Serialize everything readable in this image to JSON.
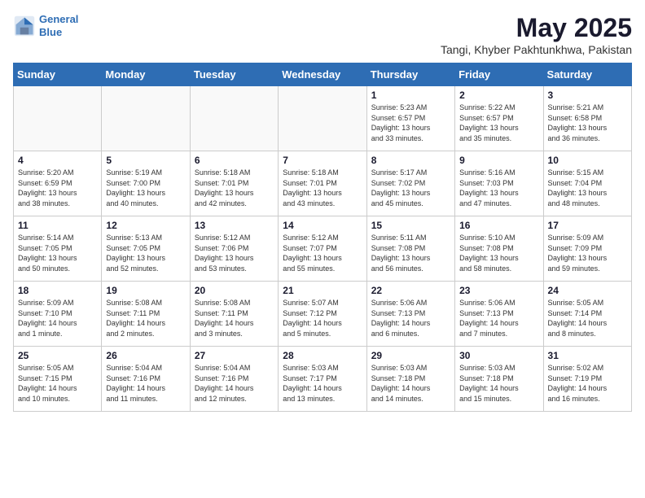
{
  "header": {
    "logo_line1": "General",
    "logo_line2": "Blue",
    "title": "May 2025",
    "subtitle": "Tangi, Khyber Pakhtunkhwa, Pakistan"
  },
  "weekdays": [
    "Sunday",
    "Monday",
    "Tuesday",
    "Wednesday",
    "Thursday",
    "Friday",
    "Saturday"
  ],
  "weeks": [
    [
      {
        "day": "",
        "info": ""
      },
      {
        "day": "",
        "info": ""
      },
      {
        "day": "",
        "info": ""
      },
      {
        "day": "",
        "info": ""
      },
      {
        "day": "1",
        "info": "Sunrise: 5:23 AM\nSunset: 6:57 PM\nDaylight: 13 hours\nand 33 minutes."
      },
      {
        "day": "2",
        "info": "Sunrise: 5:22 AM\nSunset: 6:57 PM\nDaylight: 13 hours\nand 35 minutes."
      },
      {
        "day": "3",
        "info": "Sunrise: 5:21 AM\nSunset: 6:58 PM\nDaylight: 13 hours\nand 36 minutes."
      }
    ],
    [
      {
        "day": "4",
        "info": "Sunrise: 5:20 AM\nSunset: 6:59 PM\nDaylight: 13 hours\nand 38 minutes."
      },
      {
        "day": "5",
        "info": "Sunrise: 5:19 AM\nSunset: 7:00 PM\nDaylight: 13 hours\nand 40 minutes."
      },
      {
        "day": "6",
        "info": "Sunrise: 5:18 AM\nSunset: 7:01 PM\nDaylight: 13 hours\nand 42 minutes."
      },
      {
        "day": "7",
        "info": "Sunrise: 5:18 AM\nSunset: 7:01 PM\nDaylight: 13 hours\nand 43 minutes."
      },
      {
        "day": "8",
        "info": "Sunrise: 5:17 AM\nSunset: 7:02 PM\nDaylight: 13 hours\nand 45 minutes."
      },
      {
        "day": "9",
        "info": "Sunrise: 5:16 AM\nSunset: 7:03 PM\nDaylight: 13 hours\nand 47 minutes."
      },
      {
        "day": "10",
        "info": "Sunrise: 5:15 AM\nSunset: 7:04 PM\nDaylight: 13 hours\nand 48 minutes."
      }
    ],
    [
      {
        "day": "11",
        "info": "Sunrise: 5:14 AM\nSunset: 7:05 PM\nDaylight: 13 hours\nand 50 minutes."
      },
      {
        "day": "12",
        "info": "Sunrise: 5:13 AM\nSunset: 7:05 PM\nDaylight: 13 hours\nand 52 minutes."
      },
      {
        "day": "13",
        "info": "Sunrise: 5:12 AM\nSunset: 7:06 PM\nDaylight: 13 hours\nand 53 minutes."
      },
      {
        "day": "14",
        "info": "Sunrise: 5:12 AM\nSunset: 7:07 PM\nDaylight: 13 hours\nand 55 minutes."
      },
      {
        "day": "15",
        "info": "Sunrise: 5:11 AM\nSunset: 7:08 PM\nDaylight: 13 hours\nand 56 minutes."
      },
      {
        "day": "16",
        "info": "Sunrise: 5:10 AM\nSunset: 7:08 PM\nDaylight: 13 hours\nand 58 minutes."
      },
      {
        "day": "17",
        "info": "Sunrise: 5:09 AM\nSunset: 7:09 PM\nDaylight: 13 hours\nand 59 minutes."
      }
    ],
    [
      {
        "day": "18",
        "info": "Sunrise: 5:09 AM\nSunset: 7:10 PM\nDaylight: 14 hours\nand 1 minute."
      },
      {
        "day": "19",
        "info": "Sunrise: 5:08 AM\nSunset: 7:11 PM\nDaylight: 14 hours\nand 2 minutes."
      },
      {
        "day": "20",
        "info": "Sunrise: 5:08 AM\nSunset: 7:11 PM\nDaylight: 14 hours\nand 3 minutes."
      },
      {
        "day": "21",
        "info": "Sunrise: 5:07 AM\nSunset: 7:12 PM\nDaylight: 14 hours\nand 5 minutes."
      },
      {
        "day": "22",
        "info": "Sunrise: 5:06 AM\nSunset: 7:13 PM\nDaylight: 14 hours\nand 6 minutes."
      },
      {
        "day": "23",
        "info": "Sunrise: 5:06 AM\nSunset: 7:13 PM\nDaylight: 14 hours\nand 7 minutes."
      },
      {
        "day": "24",
        "info": "Sunrise: 5:05 AM\nSunset: 7:14 PM\nDaylight: 14 hours\nand 8 minutes."
      }
    ],
    [
      {
        "day": "25",
        "info": "Sunrise: 5:05 AM\nSunset: 7:15 PM\nDaylight: 14 hours\nand 10 minutes."
      },
      {
        "day": "26",
        "info": "Sunrise: 5:04 AM\nSunset: 7:16 PM\nDaylight: 14 hours\nand 11 minutes."
      },
      {
        "day": "27",
        "info": "Sunrise: 5:04 AM\nSunset: 7:16 PM\nDaylight: 14 hours\nand 12 minutes."
      },
      {
        "day": "28",
        "info": "Sunrise: 5:03 AM\nSunset: 7:17 PM\nDaylight: 14 hours\nand 13 minutes."
      },
      {
        "day": "29",
        "info": "Sunrise: 5:03 AM\nSunset: 7:18 PM\nDaylight: 14 hours\nand 14 minutes."
      },
      {
        "day": "30",
        "info": "Sunrise: 5:03 AM\nSunset: 7:18 PM\nDaylight: 14 hours\nand 15 minutes."
      },
      {
        "day": "31",
        "info": "Sunrise: 5:02 AM\nSunset: 7:19 PM\nDaylight: 14 hours\nand 16 minutes."
      }
    ]
  ]
}
